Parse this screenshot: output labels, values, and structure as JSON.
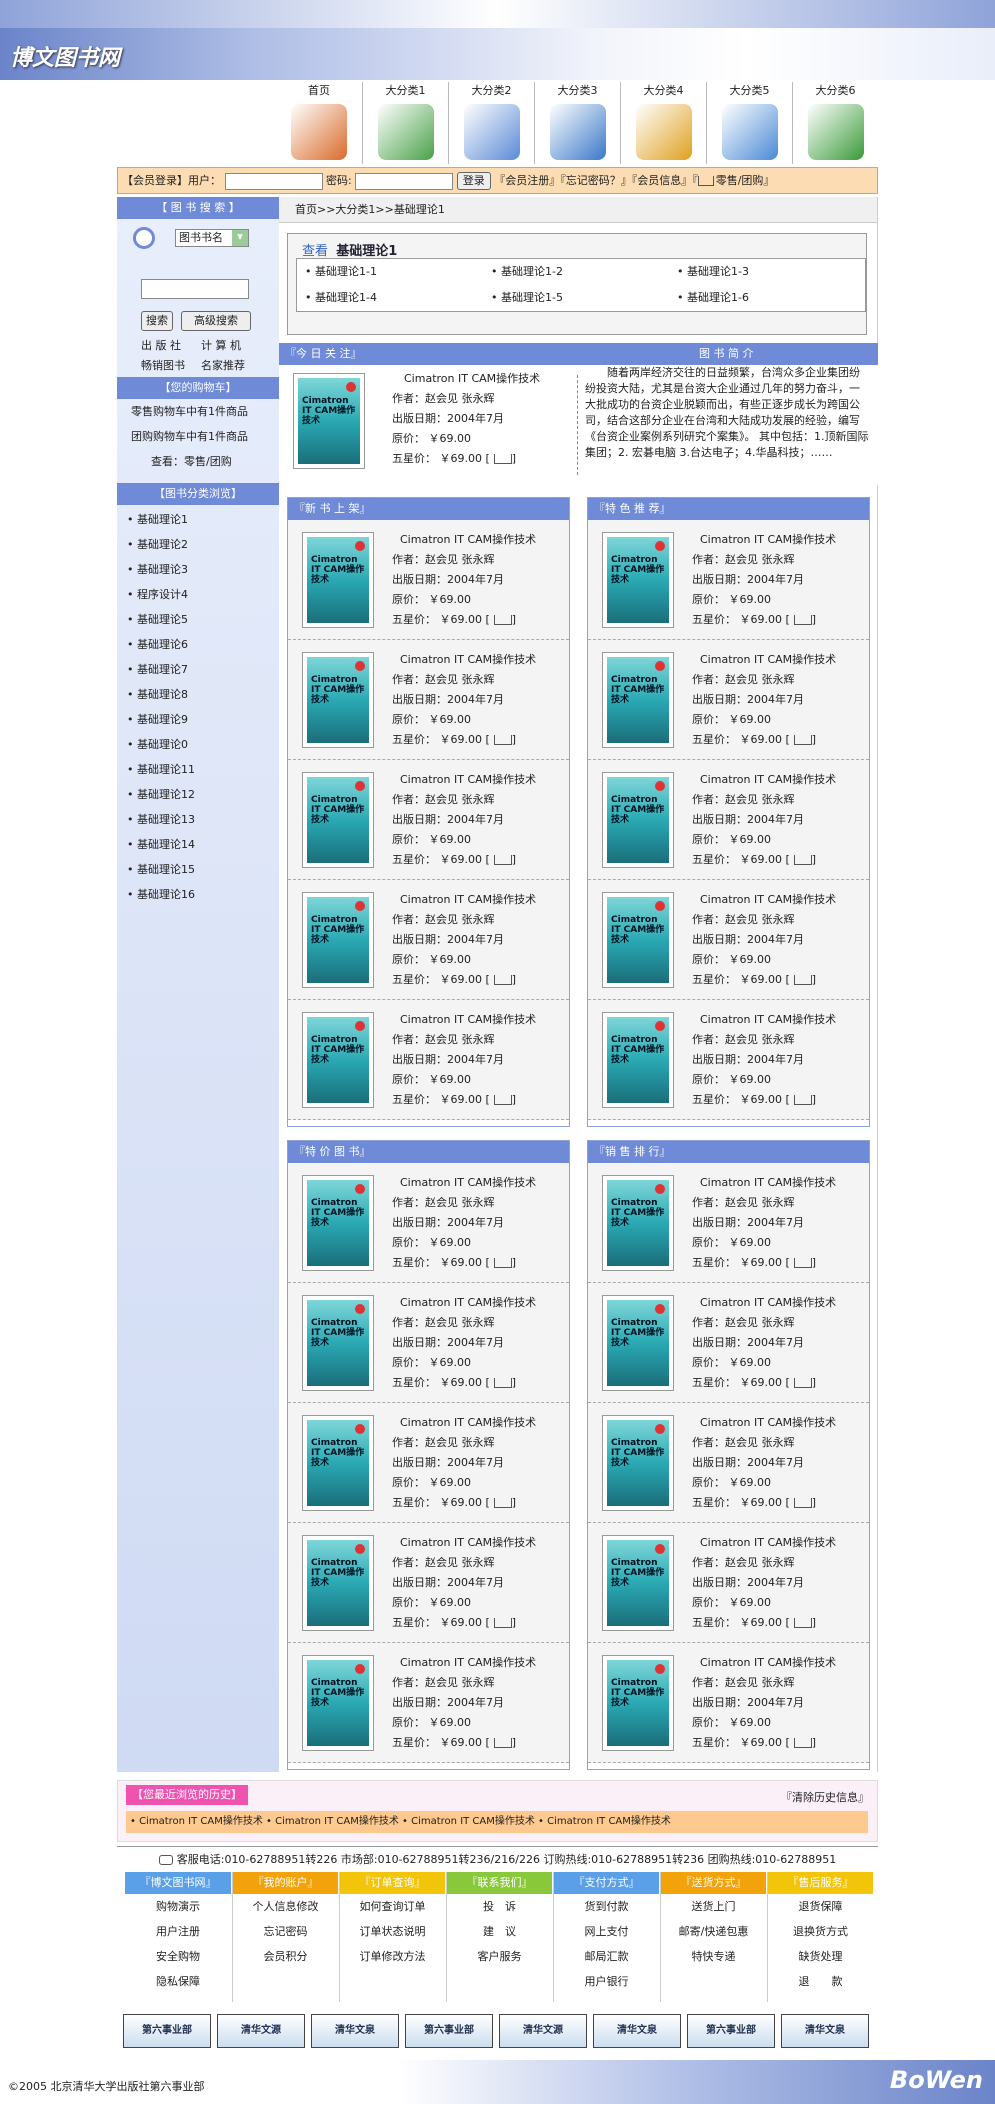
{
  "site": {
    "logo": "博文图书网",
    "footer_logo": "BoWen",
    "copyright": "©2005 北京清华大学出版社第六事业部"
  },
  "nav": [
    {
      "label": "首页",
      "icon": "book-icon"
    },
    {
      "label": "大分类1",
      "icon": "books-icon"
    },
    {
      "label": "大分类2",
      "icon": "window-icon"
    },
    {
      "label": "大分类3",
      "icon": "globe-icon"
    },
    {
      "label": "大分类4",
      "icon": "palette-icon"
    },
    {
      "label": "大分类5",
      "icon": "computer-icon"
    },
    {
      "label": "大分类6",
      "icon": "bookstack-icon"
    }
  ],
  "login": {
    "prefix": "【会员登录】用户：",
    "pwd_label": "密码:",
    "login_btn": "登录",
    "links": "『会员注册』『忘记密码？』『会员信息』『",
    "cart_link": "零售/团购』"
  },
  "search": {
    "header": "【 图 书 搜 索 】",
    "select_value": "图书书名",
    "search_btn": "搜索",
    "adv_btn": "高级搜索",
    "quick1": "出 版 社",
    "quick2": "计 算 机",
    "quick3": "畅销图书",
    "quick4": "名家推荐"
  },
  "cart": {
    "header": "【您的购物车】",
    "line1": "零售购物车中有1件商品",
    "line2": "团购购物车中有1件商品",
    "line3": "查看：零售/团购"
  },
  "categories": {
    "header": "【图书分类浏览】",
    "items": [
      "基础理论1",
      "基础理论2",
      "基础理论3",
      "程序设计4",
      "基础理论5",
      "基础理论6",
      "基础理论7",
      "基础理论8",
      "基础理论9",
      "基础理论0",
      "基础理论11",
      "基础理论12",
      "基础理论13",
      "基础理论14",
      "基础理论15",
      "基础理论16"
    ]
  },
  "breadcrumb": "首页>>大分类1>>基础理论1",
  "view": {
    "label": "查看",
    "title": "基础理论1",
    "subs": [
      "基础理论1-1",
      "基础理论1-2",
      "基础理论1-3",
      "基础理论1-4",
      "基础理论1-5",
      "基础理论1-6"
    ]
  },
  "today": {
    "header": "『今 日 关 注』",
    "intro_header": "图 书 简 介",
    "intro": "随着两岸经济交往的日益频繁，台湾众多企业集团纷纷投资大陆，尤其是台资大企业通过几年的努力奋斗，一大批成功的台资企业脱颖而出，有些正逐步成长为跨国公司，结合这部分企业在台湾和大陆成功发展的经验，编写《台资企业案例系列研究个案集》。 其中包括：1.顶新国际集团；2. 宏碁电脑 3.台达电子；4.华晶科技；……"
  },
  "book": {
    "title": "Cimatron IT CAM操作技术",
    "cover_title": "Cimatron IT CAM操作技术",
    "author": "作者：赵会见 张永辉",
    "date": "出版日期：2004年7月",
    "price": "原价： ￥69.00",
    "star": "五星价： ￥69.00  ["
  },
  "sections": {
    "new": "『新 书 上 架』",
    "recommend": "『特 色 推 荐』",
    "special": "『特 价 图 书』",
    "rank": "『销 售 排 行』"
  },
  "history": {
    "header": "【您最近浏览的历史】",
    "clear": "『清除历史信息』",
    "items": "• Cimatron IT CAM操作技术  • Cimatron IT CAM操作技术  • Cimatron IT CAM操作技术 • Cimatron IT CAM操作技术"
  },
  "contact": "客服电话:010-62788951转226 市场部:010-62788951转236/216/226  订购热线:010-62788951转236  团购热线:010-62788951",
  "footer": {
    "cols": [
      {
        "head": "『博文图书网』",
        "color": "#5aa0e8",
        "items": [
          "购物演示",
          "用户注册",
          "安全购物",
          "隐私保障"
        ]
      },
      {
        "head": "『我的账户』",
        "color": "#f2a20a",
        "items": [
          "个人信息修改",
          "忘记密码",
          "会员积分"
        ]
      },
      {
        "head": "『订单查询』",
        "color": "#f2c40a",
        "items": [
          "如何查询订单",
          "订单状态说明",
          "订单修改方法"
        ]
      },
      {
        "head": "『联系我们』",
        "color": "#88c83a",
        "items": [
          "投　诉",
          "建　议",
          "客户服务"
        ]
      },
      {
        "head": "『支付方式』",
        "color": "#5aa0e8",
        "items": [
          "货到付款",
          "网上支付",
          "邮局汇款",
          "用户银行"
        ]
      },
      {
        "head": "『送货方式』",
        "color": "#f2a20a",
        "items": [
          "送货上门",
          "邮寄/快递包惠",
          "特快专递"
        ]
      },
      {
        "head": "『售后服务』",
        "color": "#f2c40a",
        "items": [
          "退货保障",
          "退换货方式",
          "缺货处理",
          "退　　款"
        ]
      }
    ]
  },
  "sponsors": [
    "第六事业部",
    "清华文源",
    "清华文泉",
    "第六事业部",
    "清华文源",
    "清华文泉",
    "第六事业部",
    "清华文泉"
  ]
}
